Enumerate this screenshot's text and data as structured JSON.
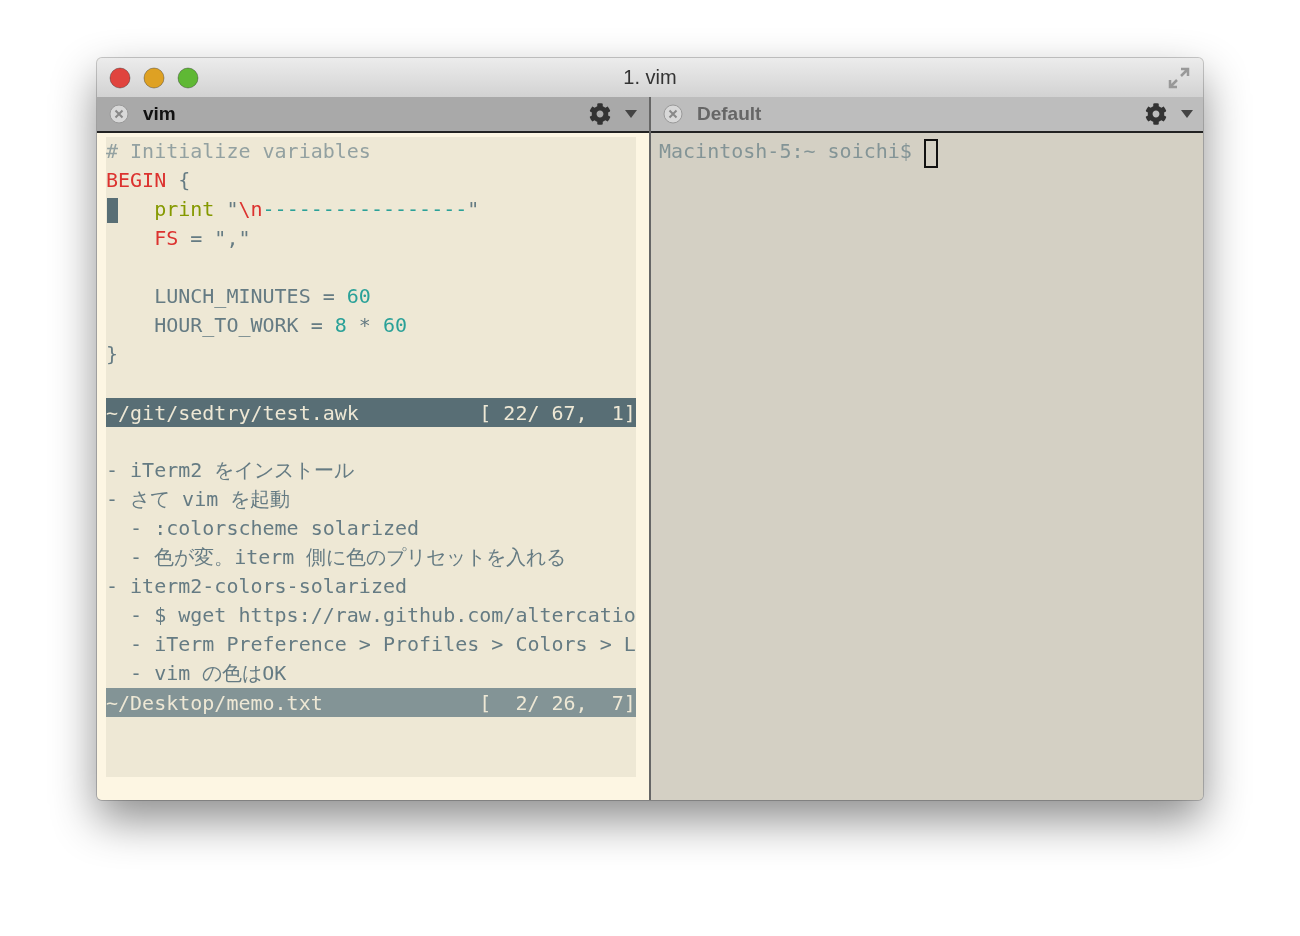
{
  "window": {
    "title": "1. vim"
  },
  "panes": [
    {
      "kind": "vim",
      "tab": {
        "title": "vim",
        "active": true
      },
      "buffers": [
        {
          "active": true,
          "lines": [
            {
              "kind": "code",
              "tokens": [
                {
                  "kind": "comment",
                  "text": "# Initialize variables"
                }
              ]
            },
            {
              "kind": "code",
              "tokens": [
                {
                  "kind": "keyword",
                  "text": "BEGIN"
                },
                {
                  "kind": "plain",
                  "text": " {"
                }
              ]
            },
            {
              "kind": "code",
              "cursor": true,
              "tokens": [
                {
                  "kind": "function",
                  "text": "    print"
                },
                {
                  "kind": "plain",
                  "text": " \""
                },
                {
                  "kind": "special",
                  "text": "\\n"
                },
                {
                  "kind": "string",
                  "text": "-----------------"
                },
                {
                  "kind": "plain",
                  "text": "\""
                }
              ]
            },
            {
              "kind": "code",
              "tokens": [
                {
                  "kind": "keyword",
                  "text": "    FS"
                },
                {
                  "kind": "plain",
                  "text": " = \",\""
                }
              ]
            },
            {
              "kind": "blank"
            },
            {
              "kind": "code",
              "tokens": [
                {
                  "kind": "plain",
                  "text": "    LUNCH_MINUTES = "
                },
                {
                  "kind": "number",
                  "text": "60"
                }
              ]
            },
            {
              "kind": "code",
              "tokens": [
                {
                  "kind": "plain",
                  "text": "    HOUR_TO_WORK = "
                },
                {
                  "kind": "number",
                  "text": "8"
                },
                {
                  "kind": "plain",
                  "text": " * "
                },
                {
                  "kind": "number",
                  "text": "60"
                }
              ]
            },
            {
              "kind": "code",
              "tokens": [
                {
                  "kind": "plain",
                  "text": "}"
                }
              ]
            },
            {
              "kind": "blank"
            }
          ],
          "status": {
            "path": "~/git/sedtry/test.awk",
            "position": "[ 22/ 67,  1]"
          }
        },
        {
          "active": false,
          "lines": [
            {
              "kind": "blank"
            },
            {
              "kind": "code",
              "tokens": [
                {
                  "kind": "plain",
                  "text": "- iTerm2 をインストール"
                }
              ]
            },
            {
              "kind": "code",
              "tokens": [
                {
                  "kind": "plain",
                  "text": "- さて vim を起動"
                }
              ]
            },
            {
              "kind": "code",
              "tokens": [
                {
                  "kind": "plain",
                  "text": "  - :colorscheme solarized"
                }
              ]
            },
            {
              "kind": "code",
              "tokens": [
                {
                  "kind": "plain",
                  "text": "  - 色が変。iterm 側に色のプリセットを入れる"
                }
              ]
            },
            {
              "kind": "code",
              "tokens": [
                {
                  "kind": "plain",
                  "text": "- iterm2-colors-solarized"
                }
              ]
            },
            {
              "kind": "code",
              "tokens": [
                {
                  "kind": "plain",
                  "text": "  - $ wget https://raw.github.com/altercatio"
                }
              ]
            },
            {
              "kind": "code",
              "tokens": [
                {
                  "kind": "plain",
                  "text": "  - iTerm Preference > Profiles > Colors > L"
                }
              ]
            },
            {
              "kind": "code",
              "tokens": [
                {
                  "kind": "plain",
                  "text": "  - vim の色はOK"
                }
              ]
            }
          ],
          "status": {
            "path": "~/Desktop/memo.txt",
            "position": "[  2/ 26,  7]"
          }
        }
      ]
    },
    {
      "kind": "shell",
      "tab": {
        "title": "Default",
        "active": false
      },
      "prompt": "Macintosh-5:~ soichi$"
    }
  ]
}
